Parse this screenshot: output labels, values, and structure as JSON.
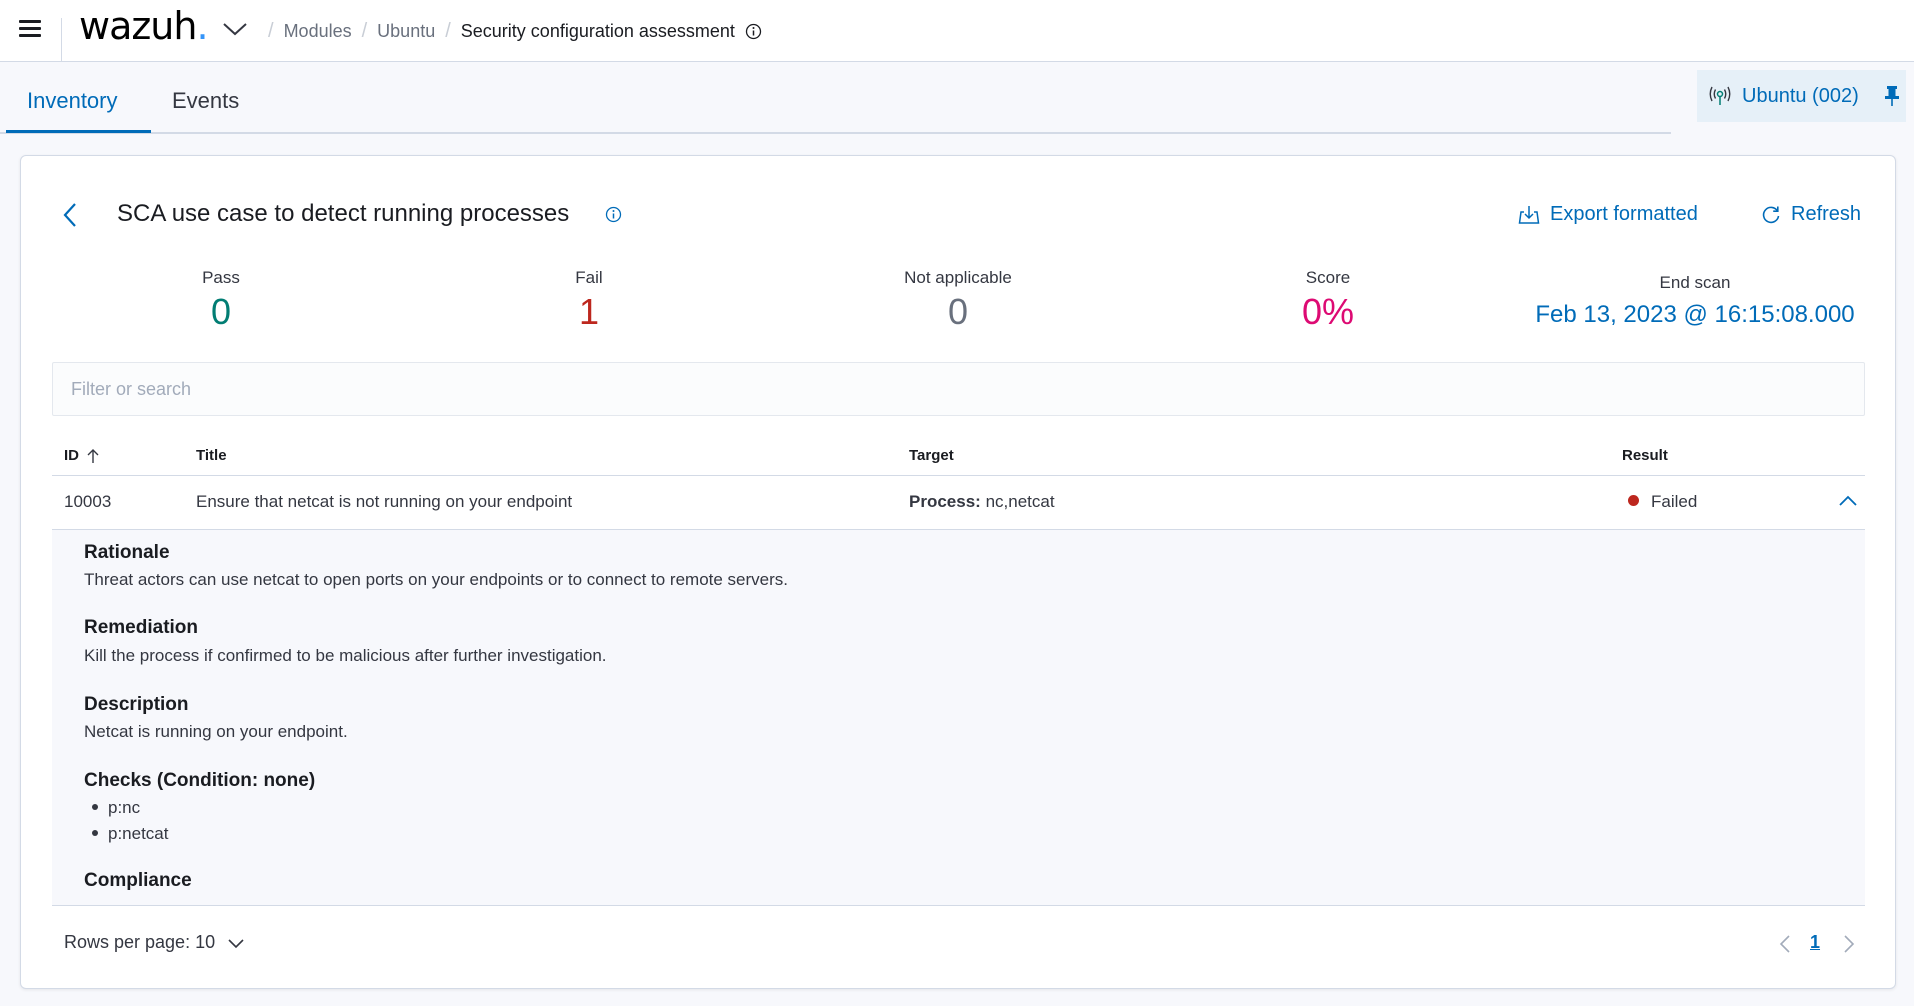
{
  "header": {
    "logo_text": "wazuh",
    "logo_dot": ".",
    "breadcrumbs": [
      {
        "label": "Modules"
      },
      {
        "label": "Ubuntu"
      },
      {
        "label": "Security configuration assessment"
      }
    ]
  },
  "tabs": [
    {
      "label": "Inventory",
      "active": true
    },
    {
      "label": "Events",
      "active": false
    }
  ],
  "agent_badge": {
    "label": "Ubuntu (002)"
  },
  "policy": {
    "title": "SCA use case to detect running processes",
    "actions": {
      "export_label": "Export formatted",
      "refresh_label": "Refresh"
    }
  },
  "stats": {
    "pass": {
      "label": "Pass",
      "value": "0",
      "color": "#017d73"
    },
    "fail": {
      "label": "Fail",
      "value": "1",
      "color": "#bd271e"
    },
    "not_applicable": {
      "label": "Not applicable",
      "value": "0",
      "color": "#69707d"
    },
    "score": {
      "label": "Score",
      "value": "0%",
      "color": "#dd0a73"
    },
    "end_scan": {
      "label": "End scan",
      "value": "Feb 13, 2023 @ 16:15:08.000"
    }
  },
  "search": {
    "placeholder": "Filter or search",
    "value": ""
  },
  "table": {
    "columns": {
      "id": "ID",
      "title": "Title",
      "target": "Target",
      "result": "Result"
    },
    "rows": [
      {
        "id": "10003",
        "title": "Ensure that netcat is not running on your endpoint",
        "target_label": "Process:",
        "target_value": "nc,netcat",
        "result": "Failed",
        "result_color": "#bd271e",
        "expanded": true
      }
    ]
  },
  "details": {
    "rationale_heading": "Rationale",
    "rationale": "Threat actors can use netcat to open ports on your endpoints or to connect to remote servers.",
    "remediation_heading": "Remediation",
    "remediation": "Kill the process if confirmed to be malicious after further investigation.",
    "description_heading": "Description",
    "description": "Netcat is running on your endpoint.",
    "checks_heading": "Checks (Condition: none)",
    "checks": [
      "p:nc",
      "p:netcat"
    ],
    "compliance_heading": "Compliance"
  },
  "pagination": {
    "rows_per_page_label": "Rows per page: 10",
    "current_page": "1"
  },
  "colors": {
    "accent": "#006bb8",
    "fail": "#bd271e",
    "pass": "#017d73",
    "score": "#dd0a73"
  }
}
